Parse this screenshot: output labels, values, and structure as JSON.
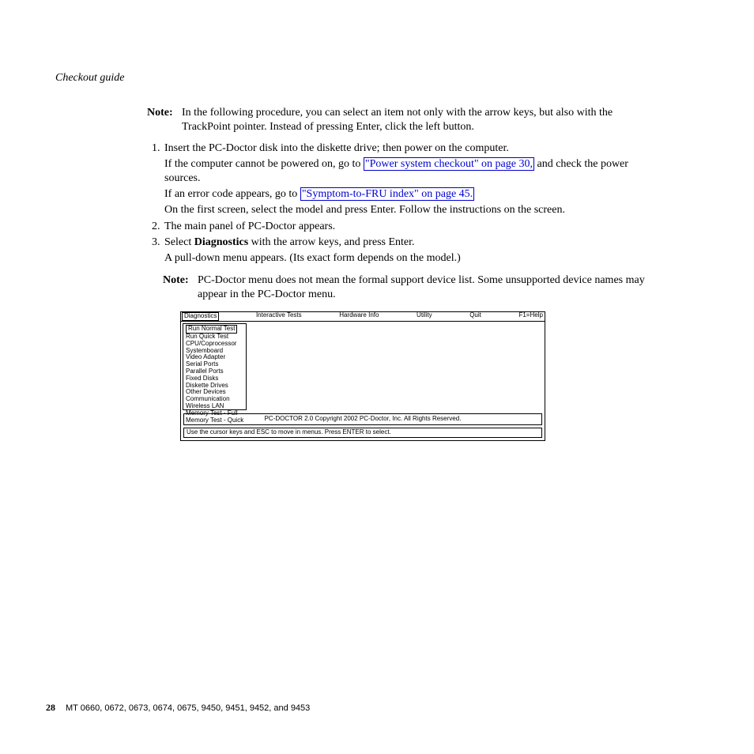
{
  "runningHead": "Checkout guide",
  "note1": {
    "label": "Note:",
    "text": "In the following procedure, you can select an item not only with the arrow keys, but also with the TrackPoint pointer. Instead of pressing Enter, click the left button."
  },
  "steps": {
    "s1": {
      "line1": "Insert the PC-Doctor disk into the diskette drive; then power on the computer.",
      "line2a": "If the computer cannot be powered on, go to ",
      "link1": "\"Power system checkout\" on page 30,",
      "line2b": " and check the power sources.",
      "line3a": "If an error code appears, go to ",
      "link2": "\"Symptom-to-FRU index\" on page 45.",
      "line4": "On the first screen, select the model and press Enter. Follow the instructions on the screen."
    },
    "s2": "The main panel of PC-Doctor appears.",
    "s3a": "Select ",
    "s3b": "Diagnostics",
    "s3c": " with the arrow keys, and press Enter.",
    "s3line2": "A pull-down menu appears. (Its exact form depends on the model.)"
  },
  "note2": {
    "label": "Note:",
    "text": "PC-Doctor menu does not mean the formal support device list. Some unsupported device names may appear in the PC-Doctor menu."
  },
  "diag": {
    "menubar": [
      "Diagnostics",
      "Interactive Tests",
      "Hardware Info",
      "Utility",
      "Quit",
      "F1=Help"
    ],
    "dropdown": [
      "Run Normal Test",
      "Run Quick Test",
      "CPU/Coprocessor",
      "Systemboard",
      "Video Adapter",
      "Serial Ports",
      "Parallel Ports",
      "Fixed Disks",
      "Diskette Drives",
      "Other Devices",
      "Communication",
      "Wireless LAN",
      "Memory Test - Full",
      "Memory Test - Quick"
    ],
    "copyright": "PC-DOCTOR 2.0   Copyright 2002  PC-Doctor,  Inc.   All Rights Reserved.",
    "status": "Use the cursor keys and ESC to move in menus.  Press ENTER to select."
  },
  "footer": {
    "pageNumber": "28",
    "models": "MT 0660, 0672, 0673, 0674, 0675, 9450, 9451, 9452, and 9453"
  }
}
